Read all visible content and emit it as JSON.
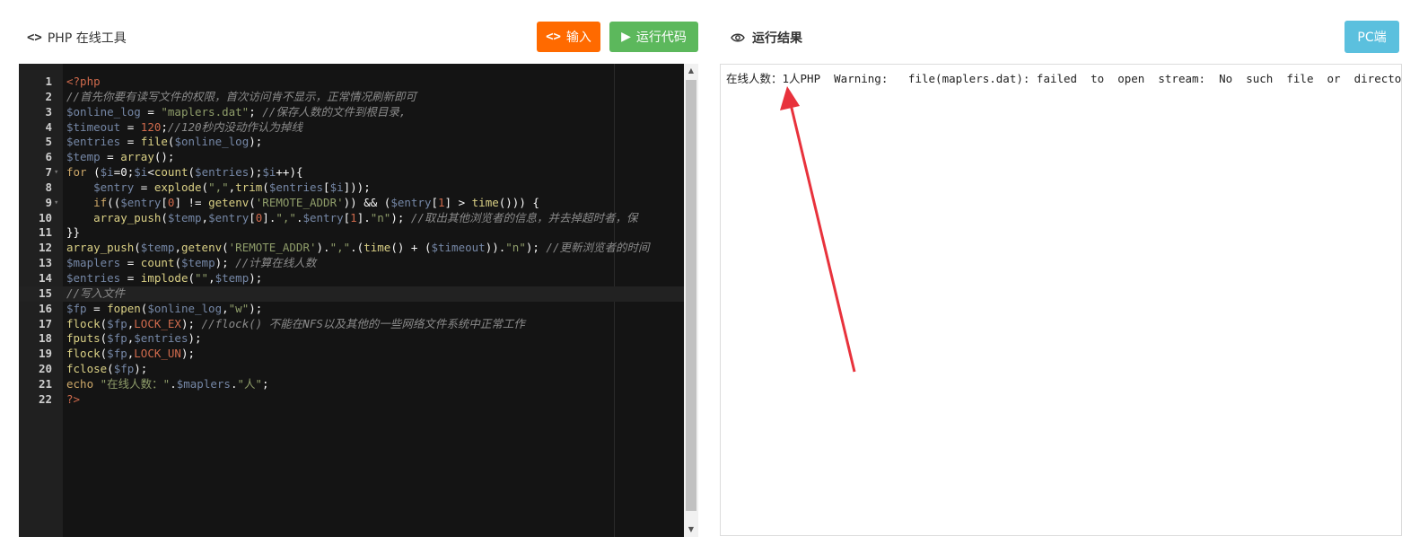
{
  "header": {
    "title": "PHP 在线工具",
    "input_button": "输入",
    "run_button": "运行代码",
    "result_title": "运行结果",
    "pc_button": "PC端"
  },
  "editor": {
    "active_line": 15,
    "lines": [
      {
        "n": "1",
        "fold": "",
        "segs": [
          {
            "t": "<?php",
            "c": "cs"
          }
        ]
      },
      {
        "n": "2",
        "fold": "",
        "segs": [
          {
            "t": "//首先你要有读写文件的权限，首次访问肯不显示，正常情况刷新即可",
            "c": "cm"
          }
        ]
      },
      {
        "n": "3",
        "fold": "",
        "segs": [
          {
            "t": "$online_log",
            "c": "vr"
          },
          {
            "t": " = ",
            "c": ""
          },
          {
            "t": "\"maplers.dat\"",
            "c": "st"
          },
          {
            "t": "; ",
            "c": ""
          },
          {
            "t": "//保存人数的文件到根目录,",
            "c": "cm"
          }
        ]
      },
      {
        "n": "4",
        "fold": "",
        "segs": [
          {
            "t": "$timeout",
            "c": "vr"
          },
          {
            "t": " = ",
            "c": ""
          },
          {
            "t": "120",
            "c": "nm"
          },
          {
            "t": ";",
            "c": ""
          },
          {
            "t": "//120秒内没动作认为掉线",
            "c": "cm"
          }
        ]
      },
      {
        "n": "5",
        "fold": "",
        "segs": [
          {
            "t": "$entries",
            "c": "vr"
          },
          {
            "t": " = ",
            "c": ""
          },
          {
            "t": "file",
            "c": "fn"
          },
          {
            "t": "(",
            "c": ""
          },
          {
            "t": "$online_log",
            "c": "vr"
          },
          {
            "t": ");",
            "c": ""
          }
        ]
      },
      {
        "n": "6",
        "fold": "",
        "segs": [
          {
            "t": "$temp",
            "c": "vr"
          },
          {
            "t": " = ",
            "c": ""
          },
          {
            "t": "array",
            "c": "fn"
          },
          {
            "t": "();",
            "c": ""
          }
        ]
      },
      {
        "n": "7",
        "fold": "▾",
        "segs": [
          {
            "t": "for",
            "c": "kw"
          },
          {
            "t": " (",
            "c": ""
          },
          {
            "t": "$i",
            "c": "vr"
          },
          {
            "t": "=0;",
            "c": ""
          },
          {
            "t": "$i",
            "c": "vr"
          },
          {
            "t": "<",
            "c": ""
          },
          {
            "t": "count",
            "c": "fn"
          },
          {
            "t": "(",
            "c": ""
          },
          {
            "t": "$entries",
            "c": "vr"
          },
          {
            "t": ");",
            "c": ""
          },
          {
            "t": "$i",
            "c": "vr"
          },
          {
            "t": "++){",
            "c": ""
          }
        ]
      },
      {
        "n": "8",
        "fold": "",
        "segs": [
          {
            "t": "    ",
            "c": ""
          },
          {
            "t": "$entry",
            "c": "vr"
          },
          {
            "t": " = ",
            "c": ""
          },
          {
            "t": "explode",
            "c": "fn"
          },
          {
            "t": "(",
            "c": ""
          },
          {
            "t": "\",\"",
            "c": "st"
          },
          {
            "t": ",",
            "c": ""
          },
          {
            "t": "trim",
            "c": "fn"
          },
          {
            "t": "(",
            "c": ""
          },
          {
            "t": "$entries",
            "c": "vr"
          },
          {
            "t": "[",
            "c": ""
          },
          {
            "t": "$i",
            "c": "vr"
          },
          {
            "t": "]));",
            "c": ""
          }
        ]
      },
      {
        "n": "9",
        "fold": "▾",
        "segs": [
          {
            "t": "    ",
            "c": ""
          },
          {
            "t": "if",
            "c": "kw"
          },
          {
            "t": "((",
            "c": ""
          },
          {
            "t": "$entry",
            "c": "vr"
          },
          {
            "t": "[",
            "c": ""
          },
          {
            "t": "0",
            "c": "nm"
          },
          {
            "t": "] != ",
            "c": ""
          },
          {
            "t": "getenv",
            "c": "fn"
          },
          {
            "t": "(",
            "c": ""
          },
          {
            "t": "'REMOTE_ADDR'",
            "c": "st"
          },
          {
            "t": ")) && (",
            "c": ""
          },
          {
            "t": "$entry",
            "c": "vr"
          },
          {
            "t": "[",
            "c": ""
          },
          {
            "t": "1",
            "c": "nm"
          },
          {
            "t": "] > ",
            "c": ""
          },
          {
            "t": "time",
            "c": "fn"
          },
          {
            "t": "())) {",
            "c": ""
          }
        ]
      },
      {
        "n": "10",
        "fold": "",
        "segs": [
          {
            "t": "    ",
            "c": ""
          },
          {
            "t": "array_push",
            "c": "fn"
          },
          {
            "t": "(",
            "c": ""
          },
          {
            "t": "$temp",
            "c": "vr"
          },
          {
            "t": ",",
            "c": ""
          },
          {
            "t": "$entry",
            "c": "vr"
          },
          {
            "t": "[",
            "c": ""
          },
          {
            "t": "0",
            "c": "nm"
          },
          {
            "t": "].",
            "c": ""
          },
          {
            "t": "\",\"",
            "c": "st"
          },
          {
            "t": ".",
            "c": ""
          },
          {
            "t": "$entry",
            "c": "vr"
          },
          {
            "t": "[",
            "c": ""
          },
          {
            "t": "1",
            "c": "nm"
          },
          {
            "t": "].",
            "c": ""
          },
          {
            "t": "\"n\"",
            "c": "st"
          },
          {
            "t": "); ",
            "c": ""
          },
          {
            "t": "//取出其他浏览者的信息，并去掉超时者，保",
            "c": "cm"
          }
        ]
      },
      {
        "n": "11",
        "fold": "",
        "segs": [
          {
            "t": "}}",
            "c": ""
          }
        ]
      },
      {
        "n": "12",
        "fold": "",
        "segs": [
          {
            "t": "array_push",
            "c": "fn"
          },
          {
            "t": "(",
            "c": ""
          },
          {
            "t": "$temp",
            "c": "vr"
          },
          {
            "t": ",",
            "c": ""
          },
          {
            "t": "getenv",
            "c": "fn"
          },
          {
            "t": "(",
            "c": ""
          },
          {
            "t": "'REMOTE_ADDR'",
            "c": "st"
          },
          {
            "t": ").",
            "c": ""
          },
          {
            "t": "\",\"",
            "c": "st"
          },
          {
            "t": ".(",
            "c": ""
          },
          {
            "t": "time",
            "c": "fn"
          },
          {
            "t": "() + (",
            "c": ""
          },
          {
            "t": "$timeout",
            "c": "vr"
          },
          {
            "t": ")).",
            "c": ""
          },
          {
            "t": "\"n\"",
            "c": "st"
          },
          {
            "t": "); ",
            "c": ""
          },
          {
            "t": "//更新浏览者的时间",
            "c": "cm"
          }
        ]
      },
      {
        "n": "13",
        "fold": "",
        "segs": [
          {
            "t": "$maplers",
            "c": "vr"
          },
          {
            "t": " = ",
            "c": ""
          },
          {
            "t": "count",
            "c": "fn"
          },
          {
            "t": "(",
            "c": ""
          },
          {
            "t": "$temp",
            "c": "vr"
          },
          {
            "t": "); ",
            "c": ""
          },
          {
            "t": "//计算在线人数",
            "c": "cm"
          }
        ]
      },
      {
        "n": "14",
        "fold": "",
        "segs": [
          {
            "t": "$entries",
            "c": "vr"
          },
          {
            "t": " = ",
            "c": ""
          },
          {
            "t": "implode",
            "c": "fn"
          },
          {
            "t": "(",
            "c": ""
          },
          {
            "t": "\"\"",
            "c": "st"
          },
          {
            "t": ",",
            "c": ""
          },
          {
            "t": "$temp",
            "c": "vr"
          },
          {
            "t": ");",
            "c": ""
          }
        ]
      },
      {
        "n": "15",
        "fold": "",
        "segs": [
          {
            "t": "//写入文件",
            "c": "cm"
          }
        ]
      },
      {
        "n": "16",
        "fold": "",
        "segs": [
          {
            "t": "$fp",
            "c": "vr"
          },
          {
            "t": " = ",
            "c": ""
          },
          {
            "t": "fopen",
            "c": "fn"
          },
          {
            "t": "(",
            "c": ""
          },
          {
            "t": "$online_log",
            "c": "vr"
          },
          {
            "t": ",",
            "c": ""
          },
          {
            "t": "\"w\"",
            "c": "st"
          },
          {
            "t": ");",
            "c": ""
          }
        ]
      },
      {
        "n": "17",
        "fold": "",
        "segs": [
          {
            "t": "flock",
            "c": "fn"
          },
          {
            "t": "(",
            "c": ""
          },
          {
            "t": "$fp",
            "c": "vr"
          },
          {
            "t": ",",
            "c": ""
          },
          {
            "t": "LOCK_EX",
            "c": "cs"
          },
          {
            "t": "); ",
            "c": ""
          },
          {
            "t": "//flock() 不能在NFS以及其他的一些网络文件系统中正常工作",
            "c": "cm"
          }
        ]
      },
      {
        "n": "18",
        "fold": "",
        "segs": [
          {
            "t": "fputs",
            "c": "fn"
          },
          {
            "t": "(",
            "c": ""
          },
          {
            "t": "$fp",
            "c": "vr"
          },
          {
            "t": ",",
            "c": ""
          },
          {
            "t": "$entries",
            "c": "vr"
          },
          {
            "t": ");",
            "c": ""
          }
        ]
      },
      {
        "n": "19",
        "fold": "",
        "segs": [
          {
            "t": "flock",
            "c": "fn"
          },
          {
            "t": "(",
            "c": ""
          },
          {
            "t": "$fp",
            "c": "vr"
          },
          {
            "t": ",",
            "c": ""
          },
          {
            "t": "LOCK_UN",
            "c": "cs"
          },
          {
            "t": ");",
            "c": ""
          }
        ]
      },
      {
        "n": "20",
        "fold": "",
        "segs": [
          {
            "t": "fclose",
            "c": "fn"
          },
          {
            "t": "(",
            "c": ""
          },
          {
            "t": "$fp",
            "c": "vr"
          },
          {
            "t": ");",
            "c": ""
          }
        ]
      },
      {
        "n": "21",
        "fold": "",
        "segs": [
          {
            "t": "echo",
            "c": "kw"
          },
          {
            "t": " ",
            "c": ""
          },
          {
            "t": "\"在线人数：\"",
            "c": "st"
          },
          {
            "t": ".",
            "c": ""
          },
          {
            "t": "$maplers",
            "c": "vr"
          },
          {
            "t": ".",
            "c": ""
          },
          {
            "t": "\"人\"",
            "c": "st"
          },
          {
            "t": ";",
            "c": ""
          }
        ]
      },
      {
        "n": "22",
        "fold": "",
        "segs": [
          {
            "t": "?>",
            "c": "cs"
          }
        ]
      }
    ]
  },
  "output": {
    "text": "在线人数：1人PHP  Warning:   file(maplers.dat): failed  to  open  stream:  No  such  file  or  directory  i"
  },
  "colors": {
    "input_button": "#ff6a00",
    "run_button": "#5cb85c",
    "pc_button": "#5bc0de",
    "editor_bg": "#141414",
    "annotation_arrow": "#e8323c"
  },
  "icons": {
    "header_left": "code-brackets-icon",
    "input_button": "code-brackets-icon",
    "run_button": "play-icon",
    "result_title": "eye-icon"
  }
}
